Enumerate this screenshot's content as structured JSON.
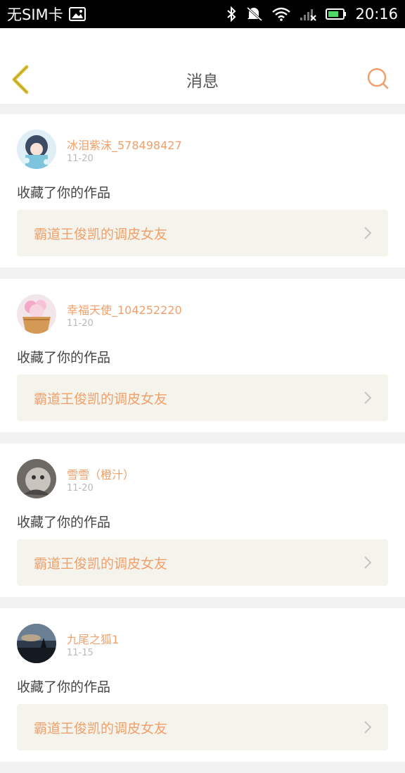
{
  "status_bar": {
    "carrier": "无SIM卡",
    "time": "20:16"
  },
  "header": {
    "title": "消息"
  },
  "colors": {
    "accent": "#f0a06a",
    "back_icon": "#e0c33a"
  },
  "messages": [
    {
      "username": "冰泪紫沫_578498427",
      "date": "11-20",
      "action": "收藏了你的作品",
      "work_title": "霸道王俊凯的调皮女友"
    },
    {
      "username": "幸福天使_104252220",
      "date": "11-20",
      "action": "收藏了你的作品",
      "work_title": "霸道王俊凯的调皮女友"
    },
    {
      "username": "雪雪（橙汁）",
      "date": "11-20",
      "action": "收藏了你的作品",
      "work_title": "霸道王俊凯的调皮女友"
    },
    {
      "username": "九尾之狐1",
      "date": "11-15",
      "action": "收藏了你的作品",
      "work_title": "霸道王俊凯的调皮女友"
    }
  ]
}
